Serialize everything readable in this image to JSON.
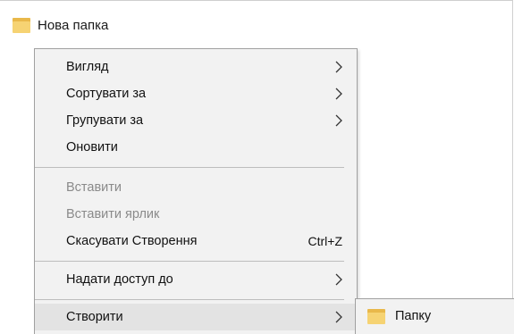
{
  "desktop": {
    "folder": {
      "icon": "folder-icon",
      "label": "Нова папка"
    }
  },
  "context_menu": {
    "items": [
      {
        "label": "Вигляд",
        "submenu": true,
        "enabled": true
      },
      {
        "label": "Сортувати за",
        "submenu": true,
        "enabled": true
      },
      {
        "label": "Групувати за",
        "submenu": true,
        "enabled": true
      },
      {
        "label": "Оновити",
        "submenu": false,
        "enabled": true
      },
      {
        "label": "Вставити",
        "submenu": false,
        "enabled": false
      },
      {
        "label": "Вставити ярлик",
        "submenu": false,
        "enabled": false
      },
      {
        "label": "Скасувати Створення",
        "shortcut": "Ctrl+Z",
        "submenu": false,
        "enabled": true
      },
      {
        "label": "Надати доступ до",
        "submenu": true,
        "enabled": true
      },
      {
        "label": "Створити",
        "submenu": true,
        "enabled": true,
        "highlighted": true
      }
    ]
  },
  "submenu": {
    "items": [
      {
        "icon": "folder-icon",
        "label": "Папку"
      }
    ]
  },
  "colors": {
    "menu_background": "#f2f2f2",
    "menu_border": "#a0a0a0",
    "disabled_text": "#8a8a8a",
    "highlight": "#e3e3e3",
    "folder_yellow": "#f6d373"
  }
}
